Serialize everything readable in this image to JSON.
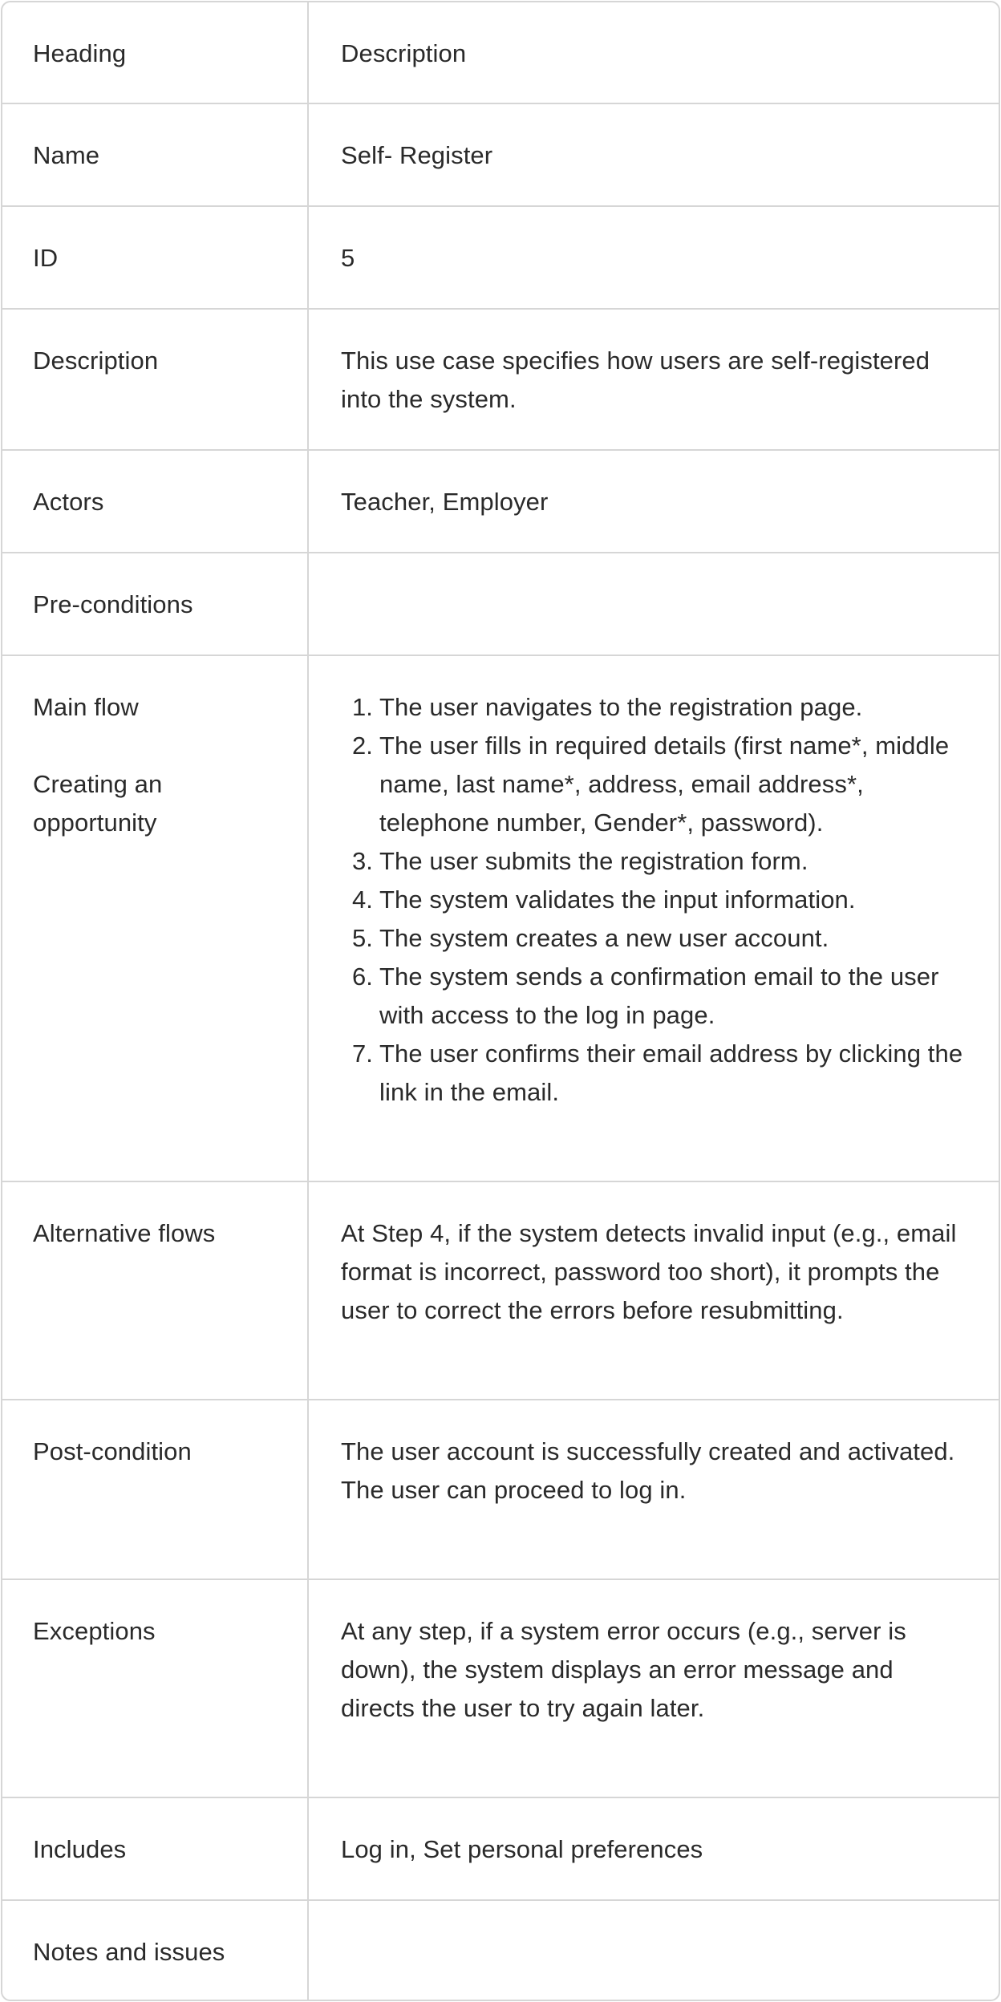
{
  "header": {
    "heading": "Heading",
    "description": "Description"
  },
  "name": {
    "label": "Name",
    "value": "Self- Register"
  },
  "id": {
    "label": "ID",
    "value": "5"
  },
  "description": {
    "label": "Description",
    "value": "This use case specifies how users are self-registered into the system."
  },
  "actors": {
    "label": "Actors",
    "value": "Teacher, Employer"
  },
  "preconditions": {
    "label": "Pre-conditions",
    "value": ""
  },
  "main_flow": {
    "label": "Main flow",
    "sublabel": "Creating an opportunity",
    "steps": [
      {
        "num": "1.",
        "text": "The user navigates to the registration page."
      },
      {
        "num": "2.",
        "text": "The user fills in required details (first name*, middle name, last name*, address, email address*, telephone number, Gender*, password)."
      },
      {
        "num": "3.",
        "text": "The user submits the registration form."
      },
      {
        "num": "4.",
        "text": "The system validates the input information."
      },
      {
        "num": "5.",
        "text": "The system creates a new user account."
      },
      {
        "num": "6.",
        "text": "The system sends a confirmation email to the user with access to the log in page."
      },
      {
        "num": "7.",
        "text": "The user confirms their email address by clicking the link in the email."
      }
    ]
  },
  "alternative_flows": {
    "label": "Alternative flows",
    "value": "At Step 4, if the system detects invalid input (e.g., email format is incorrect, password too short), it prompts the user to correct the errors before resubmitting."
  },
  "postcondition": {
    "label": "Post-condition",
    "line1": "The user account is successfully created and activated.",
    "line2": "The user can proceed to log in."
  },
  "exceptions": {
    "label": "Exceptions",
    "value": "At any step, if a system error occurs (e.g., server is down), the system displays an error message and directs the user to try again later."
  },
  "includes": {
    "label": "Includes",
    "value": "Log in, Set personal preferences"
  },
  "notes": {
    "label": "Notes and issues",
    "value": ""
  }
}
